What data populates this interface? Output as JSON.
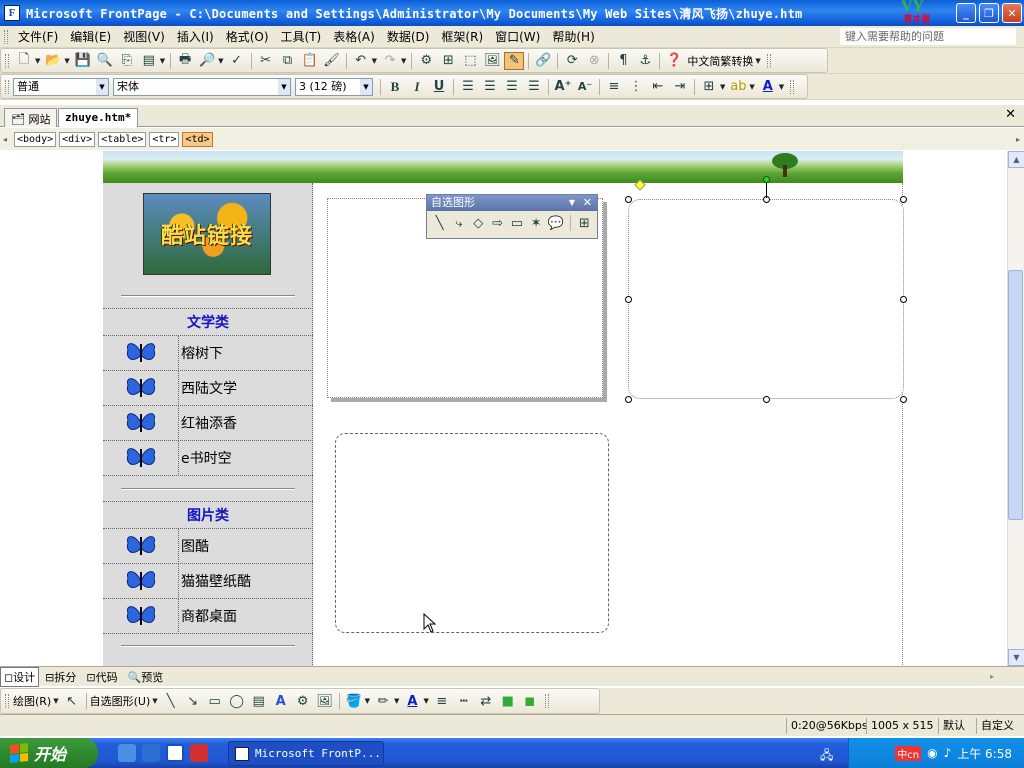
{
  "window": {
    "title": "Microsoft FrontPage - C:\\Documents and Settings\\Administrator\\My Documents\\My Web Sites\\清风飞扬\\zhuye.htm",
    "logo_text": "育才星",
    "buttons": [
      "minimize",
      "restore",
      "close"
    ]
  },
  "menubar": {
    "items": [
      "文件(F)",
      "编辑(E)",
      "视图(V)",
      "插入(I)",
      "格式(O)",
      "工具(T)",
      "表格(A)",
      "数据(D)",
      "框架(R)",
      "窗口(W)",
      "帮助(H)"
    ],
    "help_placeholder": "键入需要帮助的问题"
  },
  "toolbar": {
    "convert_label": "中文简繁转换",
    "style": "普通",
    "font": "宋体",
    "size": "3 (12 磅)",
    "bold": "B",
    "italic": "I",
    "underline": "U"
  },
  "tabs": {
    "site": "网站",
    "file": "zhuye.htm*"
  },
  "breadcrumb": [
    "<body>",
    "<div>",
    "<table>",
    "<tr>",
    "<td>"
  ],
  "sidebar": {
    "picture_text": "酷站链接",
    "categories": [
      {
        "title": "文学类",
        "items": [
          "榕树下",
          "西陆文学",
          "红袖添香",
          "e书时空"
        ]
      },
      {
        "title": "图片类",
        "items": [
          "图酷",
          "猫猫壁纸酷",
          "商都桌面"
        ]
      }
    ]
  },
  "autoshapes_toolbar": {
    "title": "自选图形"
  },
  "view_tabs": [
    "设计",
    "拆分",
    "代码",
    "预览"
  ],
  "drawing_toolbar": {
    "draw_label": "绘图(R)",
    "autoshapes_label": "自选图形(U)"
  },
  "statusbar": {
    "speed": "0:20@56Kbps",
    "size": "1005 x 515",
    "mode": "默认",
    "custom": "自定义"
  },
  "taskbar": {
    "start": "开始",
    "task": "Microsoft FrontP...",
    "clock": "上午 6:58"
  }
}
